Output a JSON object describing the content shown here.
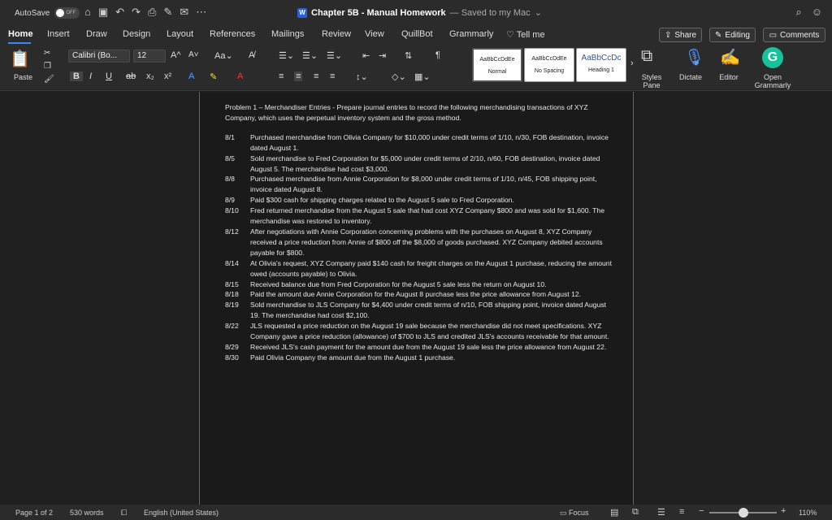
{
  "titlebar": {
    "autosave_label": "AutoSave",
    "autosave_state": "OFF",
    "doc_title": "Chapter 5B - Manual Homework",
    "saved_status": "— Saved to my Mac"
  },
  "menu": {
    "tabs": [
      "Home",
      "Insert",
      "Draw",
      "Design",
      "Layout",
      "References",
      "Mailings",
      "Review",
      "View",
      "QuillBot",
      "Grammarly"
    ],
    "tell_me": "Tell me",
    "share": "Share",
    "editing": "Editing",
    "comments": "Comments"
  },
  "ribbon": {
    "paste": "Paste",
    "font_name": "Calibri (Bo...",
    "font_size": "12",
    "styles": [
      {
        "sample": "AaBbCcDdEe",
        "name": "Normal"
      },
      {
        "sample": "AaBbCcDdEe",
        "name": "No Spacing"
      },
      {
        "sample": "AaBbCcDc",
        "name": "Heading 1"
      }
    ],
    "styles_pane": "Styles Pane",
    "dictate": "Dictate",
    "editor": "Editor",
    "open_grammarly": "Open Grammarly"
  },
  "document": {
    "intro": "Problem 1 – Merchandiser Entries - Prepare journal entries to record the following merchandising transactions of XYZ Company, which uses the perpetual inventory system and the gross method.",
    "entries": [
      {
        "date": "8/1",
        "text": "Purchased merchandise from Olivia Company for $10,000 under credit terms of 1/10, n/30, FOB destination, invoice dated August 1."
      },
      {
        "date": "8/5",
        "text": "Sold merchandise to Fred Corporation for $5,000 under credit terms of 2/10, n/60, FOB destination, invoice dated August 5. The merchandise had cost $3,000."
      },
      {
        "date": "8/8",
        "text": "Purchased merchandise from Annie Corporation for $8,000 under credit terms of 1/10, n/45, FOB shipping point, invoice dated August 8."
      },
      {
        "date": "8/9",
        "text": "Paid $300 cash for shipping charges related to the August 5 sale to Fred Corporation."
      },
      {
        "date": "8/10",
        "text": "Fred returned merchandise from the August 5 sale that had cost XYZ Company $800 and was sold for $1,600. The merchandise was restored to inventory."
      },
      {
        "date": "8/12",
        "text": "After negotiations with Annie Corporation concerning problems with the purchases on August 8, XYZ Company received a price reduction from Annie of $800 off the $8,000 of goods purchased. XYZ Company debited accounts payable for $800."
      },
      {
        "date": "8/14",
        "text": "At Olivia's request, XYZ Company paid $140 cash for freight charges on the August 1 purchase, reducing the amount owed (accounts payable) to Olivia."
      },
      {
        "date": "8/15",
        "text": "Received balance due from Fred Corporation for the August 5 sale less the return on August 10."
      },
      {
        "date": "8/18",
        "text": "Paid the amount due Annie Corporation for the August 8 purchase less the price allowance from August 12."
      },
      {
        "date": "8/19",
        "text": "Sold merchandise to JLS Company for $4,400 under credit terms of n/10, FOB shipping point, invoice dated August 19. The merchandise had cost $2,100."
      },
      {
        "date": "8/22",
        "text": "JLS requested a price reduction on the August 19 sale because the merchandise did not meet specifications. XYZ Company gave a price reduction (allowance) of $700 to JLS and credited JLS's accounts receivable for that amount."
      },
      {
        "date": "8/29",
        "text": "Received JLS's cash payment for the amount due from the August 19 sale less the price allowance from August 22."
      },
      {
        "date": "8/30",
        "text": "Paid Olivia Company the amount due from the August 1 purchase."
      }
    ]
  },
  "status": {
    "page": "Page 1 of 2",
    "words": "530 words",
    "language": "English (United States)",
    "focus": "Focus",
    "zoom": "110%",
    "zoom_level": 0.5
  }
}
